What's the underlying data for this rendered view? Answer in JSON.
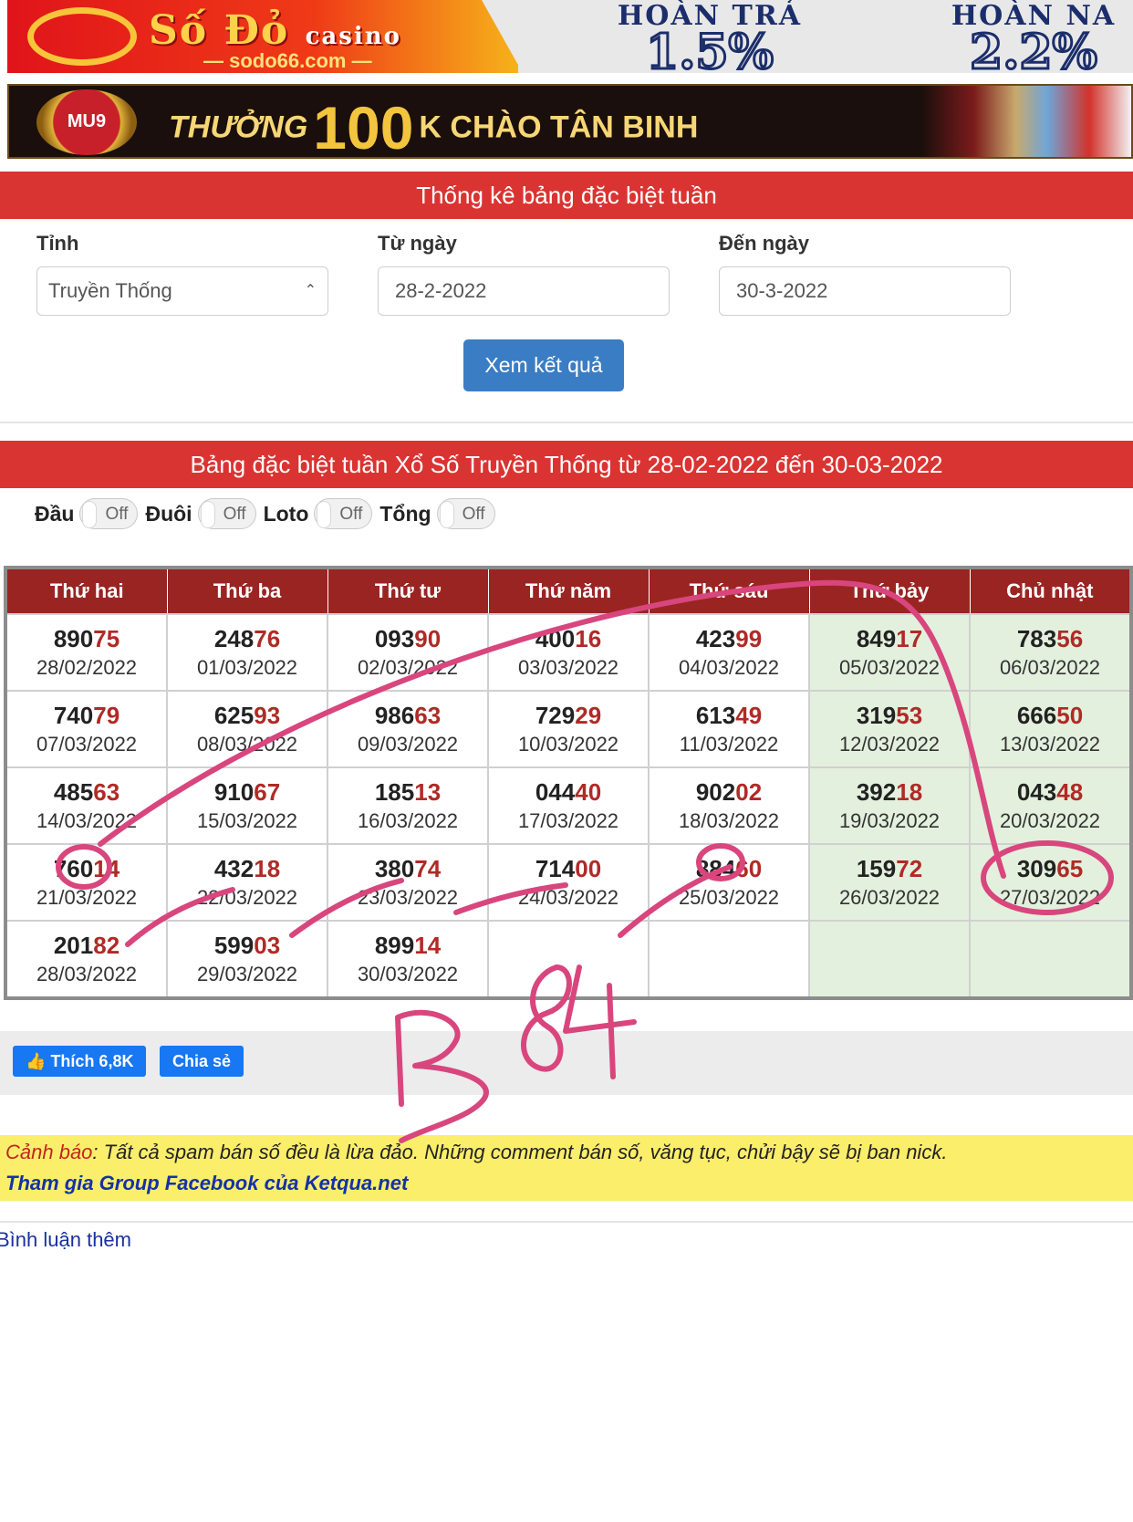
{
  "banner_top": {
    "brand": "Số Đỏ",
    "brand_sub": "casino",
    "domain": "— sodo66.com —",
    "offer1_title": "HOÀN TRẢ",
    "offer1_value": "1.5%",
    "offer2_title": "HOÀN NA",
    "offer2_value": "2.2%"
  },
  "banner_mu9": {
    "badge": "MU9",
    "text_a": "THƯỞNG",
    "text_b": "100",
    "text_c": "K CHÀO TÂN BINH"
  },
  "form": {
    "section_title": "Thống kê bảng đặc biệt tuần",
    "province_label": "Tỉnh",
    "province_value": "Truyền Thống",
    "from_label": "Từ ngày",
    "from_value": "28-2-2022",
    "to_label": "Đến ngày",
    "to_value": "30-3-2022",
    "submit": "Xem kết quả"
  },
  "results": {
    "title": "Bảng đặc biệt tuần Xổ Số Truyền Thống từ 28-02-2022 đến 30-03-2022",
    "toggles": [
      {
        "label": "Đầu",
        "state": "Off"
      },
      {
        "label": "Đuôi",
        "state": "Off"
      },
      {
        "label": "Loto",
        "state": "Off"
      },
      {
        "label": "Tổng",
        "state": "Off"
      }
    ],
    "headers": [
      "Thứ hai",
      "Thứ ba",
      "Thứ tư",
      "Thứ năm",
      "Thứ sáu",
      "Thứ bảy",
      "Chủ nhật"
    ],
    "rows": [
      [
        {
          "head": "890",
          "tail": "75",
          "date": "28/02/2022"
        },
        {
          "head": "248",
          "tail": "76",
          "date": "01/03/2022"
        },
        {
          "head": "093",
          "tail": "90",
          "date": "02/03/2022"
        },
        {
          "head": "400",
          "tail": "16",
          "date": "03/03/2022"
        },
        {
          "head": "423",
          "tail": "99",
          "date": "04/03/2022"
        },
        {
          "head": "849",
          "tail": "17",
          "date": "05/03/2022"
        },
        {
          "head": "783",
          "tail": "56",
          "date": "06/03/2022"
        }
      ],
      [
        {
          "head": "740",
          "tail": "79",
          "date": "07/03/2022"
        },
        {
          "head": "625",
          "tail": "93",
          "date": "08/03/2022"
        },
        {
          "head": "986",
          "tail": "63",
          "date": "09/03/2022"
        },
        {
          "head": "729",
          "tail": "29",
          "date": "10/03/2022"
        },
        {
          "head": "613",
          "tail": "49",
          "date": "11/03/2022"
        },
        {
          "head": "319",
          "tail": "53",
          "date": "12/03/2022"
        },
        {
          "head": "666",
          "tail": "50",
          "date": "13/03/2022"
        }
      ],
      [
        {
          "head": "485",
          "tail": "63",
          "date": "14/03/2022"
        },
        {
          "head": "910",
          "tail": "67",
          "date": "15/03/2022"
        },
        {
          "head": "185",
          "tail": "13",
          "date": "16/03/2022"
        },
        {
          "head": "044",
          "tail": "40",
          "date": "17/03/2022"
        },
        {
          "head": "902",
          "tail": "02",
          "date": "18/03/2022"
        },
        {
          "head": "392",
          "tail": "18",
          "date": "19/03/2022"
        },
        {
          "head": "043",
          "tail": "48",
          "date": "20/03/2022"
        }
      ],
      [
        {
          "head": "760",
          "tail": "14",
          "date": "21/03/2022"
        },
        {
          "head": "432",
          "tail": "18",
          "date": "22/03/2022"
        },
        {
          "head": "380",
          "tail": "74",
          "date": "23/03/2022"
        },
        {
          "head": "714",
          "tail": "00",
          "date": "24/03/2022"
        },
        {
          "head": "884",
          "tail": "60",
          "date": "25/03/2022"
        },
        {
          "head": "159",
          "tail": "72",
          "date": "26/03/2022"
        },
        {
          "head": "309",
          "tail": "65",
          "date": "27/03/2022"
        }
      ],
      [
        {
          "head": "201",
          "tail": "82",
          "date": "28/03/2022"
        },
        {
          "head": "599",
          "tail": "03",
          "date": "29/03/2022"
        },
        {
          "head": "899",
          "tail": "14",
          "date": "30/03/2022"
        },
        null,
        null,
        null,
        null
      ]
    ]
  },
  "social": {
    "like": "Thích 6,8K",
    "share": "Chia sẻ"
  },
  "warning": {
    "keyword": "Cảnh báo",
    "text": ": Tất cả spam bán số đều là lừa đảo. Những comment bán số, văng tục, chửi bậy sẽ bị ban nick.",
    "group_link": "Tham gia Group Facebook của Ketqua.net"
  },
  "more_comments": "Bình luận thêm",
  "annotation": {
    "handwritten": "B 84",
    "ink_color": "#d8467d"
  }
}
